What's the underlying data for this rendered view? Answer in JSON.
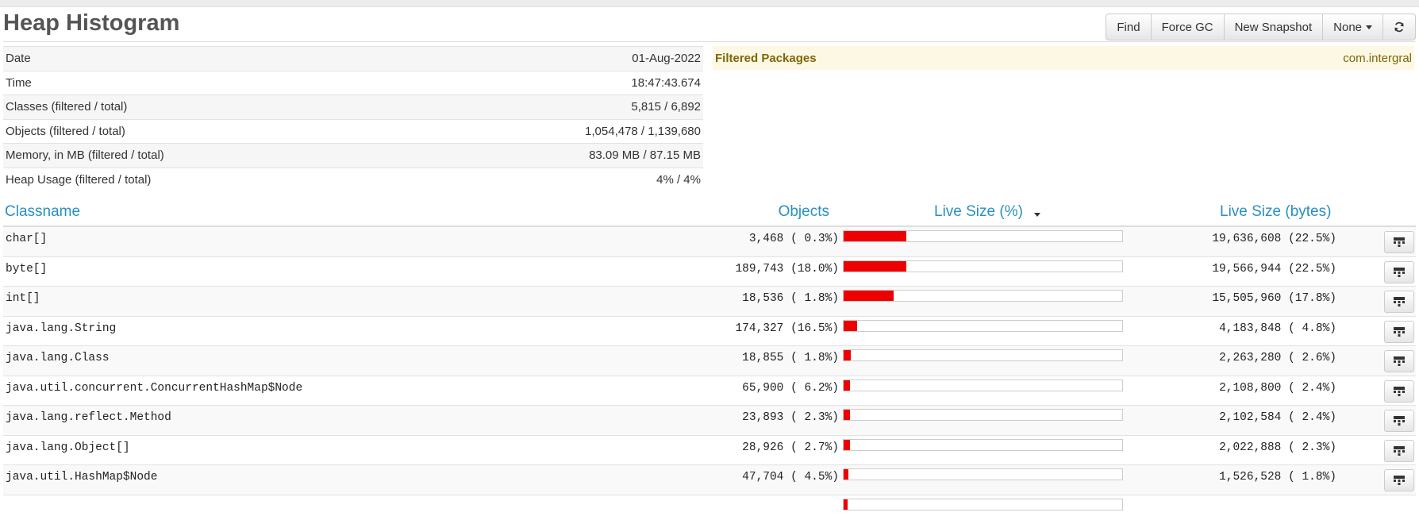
{
  "page": {
    "title": "Heap Histogram"
  },
  "toolbar": {
    "find": "Find",
    "force_gc": "Force GC",
    "new_snapshot": "New Snapshot",
    "filter_select": "None"
  },
  "summary": [
    {
      "label": "Date",
      "value": "01-Aug-2022"
    },
    {
      "label": "Time",
      "value": "18:47:43.674"
    },
    {
      "label": "Classes (filtered / total)",
      "value": "5,815 / 6,892"
    },
    {
      "label": "Objects (filtered / total)",
      "value": "1,054,478 / 1,139,680"
    },
    {
      "label": "Memory, in MB (filtered / total)",
      "value": "83.09 MB / 87.15 MB"
    },
    {
      "label": "Heap Usage (filtered / total)",
      "value": "4% / 4%"
    }
  ],
  "filtered_packages": {
    "label": "Filtered Packages",
    "value": "com.intergral"
  },
  "table": {
    "columns": {
      "classname": "Classname",
      "objects": "Objects",
      "live_size_pct": "Live Size (%)",
      "live_size_bytes": "Live Size (bytes)"
    },
    "rows": [
      {
        "classname": "char[]",
        "objects": "3,468 ( 0.3%)",
        "bytes": "19,636,608 (22.5%)",
        "live_pct": 22.5
      },
      {
        "classname": "byte[]",
        "objects": "189,743 (18.0%)",
        "bytes": "19,566,944 (22.5%)",
        "live_pct": 22.5
      },
      {
        "classname": "int[]",
        "objects": "18,536 ( 1.8%)",
        "bytes": "15,505,960 (17.8%)",
        "live_pct": 17.8
      },
      {
        "classname": "java.lang.String",
        "objects": "174,327 (16.5%)",
        "bytes": "4,183,848 ( 4.8%)",
        "live_pct": 4.8
      },
      {
        "classname": "java.lang.Class",
        "objects": "18,855 ( 1.8%)",
        "bytes": "2,263,280 ( 2.6%)",
        "live_pct": 2.6
      },
      {
        "classname": "java.util.concurrent.ConcurrentHashMap$Node",
        "objects": "65,900 ( 6.2%)",
        "bytes": "2,108,800 ( 2.4%)",
        "live_pct": 2.4
      },
      {
        "classname": "java.lang.reflect.Method",
        "objects": "23,893 ( 2.3%)",
        "bytes": "2,102,584 ( 2.4%)",
        "live_pct": 2.4
      },
      {
        "classname": "java.lang.Object[]",
        "objects": "28,926 ( 2.7%)",
        "bytes": "2,022,888 ( 2.3%)",
        "live_pct": 2.3
      },
      {
        "classname": "java.util.HashMap$Node",
        "objects": "47,704 ( 4.5%)",
        "bytes": "1,526,528 ( 1.8%)",
        "live_pct": 1.8
      },
      {
        "classname": "",
        "objects": "",
        "bytes": "",
        "live_pct": 1.5
      }
    ]
  },
  "icons": {
    "refresh": "refresh-icon",
    "references": "hierarchy-icon",
    "dropdown": "caret-down-icon",
    "sort": "sort-desc-icon"
  },
  "colors": {
    "bar": "#ee0000",
    "link": "#2a8fc4",
    "filter_bg": "#fcf8e3",
    "filter_text": "#7d6608"
  }
}
